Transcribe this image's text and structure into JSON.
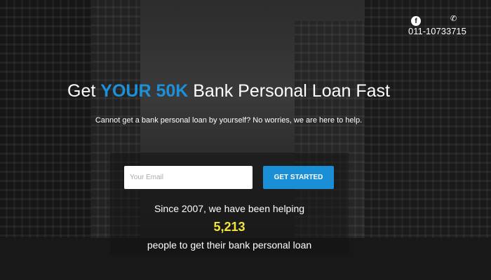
{
  "header": {
    "facebook_icon": "facebook-icon",
    "phone_icon": "phone-icon",
    "phone": "011-10733715"
  },
  "hero": {
    "title_pre": "Get ",
    "title_highlight": "YOUR 50K",
    "title_post": " Bank Personal Loan Fast",
    "subtitle": "Cannot get a bank personal loan by yourself? No worries, we are here to help."
  },
  "form": {
    "email_placeholder": "Your Email",
    "button": "GET STARTED"
  },
  "stats": {
    "line1": "Since 2007, we have been helping",
    "count": "5,213",
    "line2": "people to get their bank personal loan"
  },
  "colors": {
    "accent": "#1b8fd6",
    "count": "#f1e53a"
  }
}
